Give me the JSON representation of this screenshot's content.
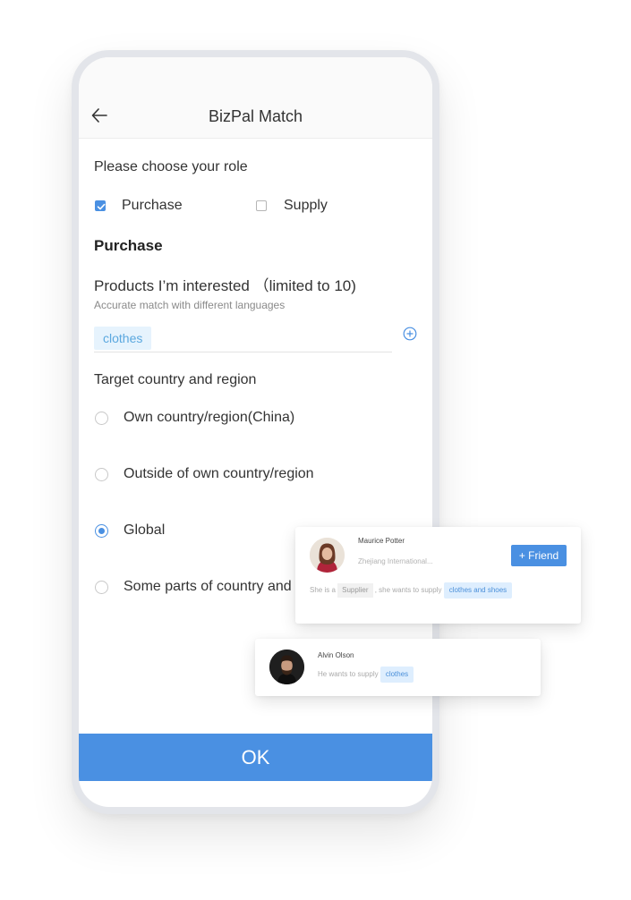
{
  "header": {
    "title": "BizPal Match",
    "back_icon": "arrow-left-icon"
  },
  "role": {
    "question": "Please choose your role",
    "options": [
      {
        "label": "Purchase",
        "checked": true
      },
      {
        "label": "Supply",
        "checked": false
      }
    ]
  },
  "purchase": {
    "section_title": "Purchase",
    "products_label": "Products I’m interested （limited to 10)",
    "products_hint": "Accurate match with different languages",
    "tags": [
      "clothes"
    ],
    "add_icon": "plus-circle-icon"
  },
  "target": {
    "title": "Target country and region",
    "options": [
      {
        "label": "Own country/region(China)",
        "selected": false
      },
      {
        "label": "Outside of own country/region",
        "selected": false
      },
      {
        "label": "Global",
        "selected": true
      },
      {
        "label": "Some parts of country and region",
        "selected": false
      }
    ]
  },
  "ok_label": "OK",
  "cards": {
    "first": {
      "name": "Maurice Potter",
      "company": "Zhejiang International...",
      "friend_label": "+ Friend",
      "text_prefix": "She is a",
      "role_chip": "Supplier",
      "text_middle": ",  she wants to supply",
      "supply_chip": "clothes and  shoes"
    },
    "second": {
      "name": "Alvin Olson",
      "text": "He  wants to supply",
      "supply_chip": "clothes"
    }
  },
  "colors": {
    "accent": "#4a90e2",
    "tag_bg": "#e6f3fd",
    "tag_text": "#5ba8df"
  }
}
